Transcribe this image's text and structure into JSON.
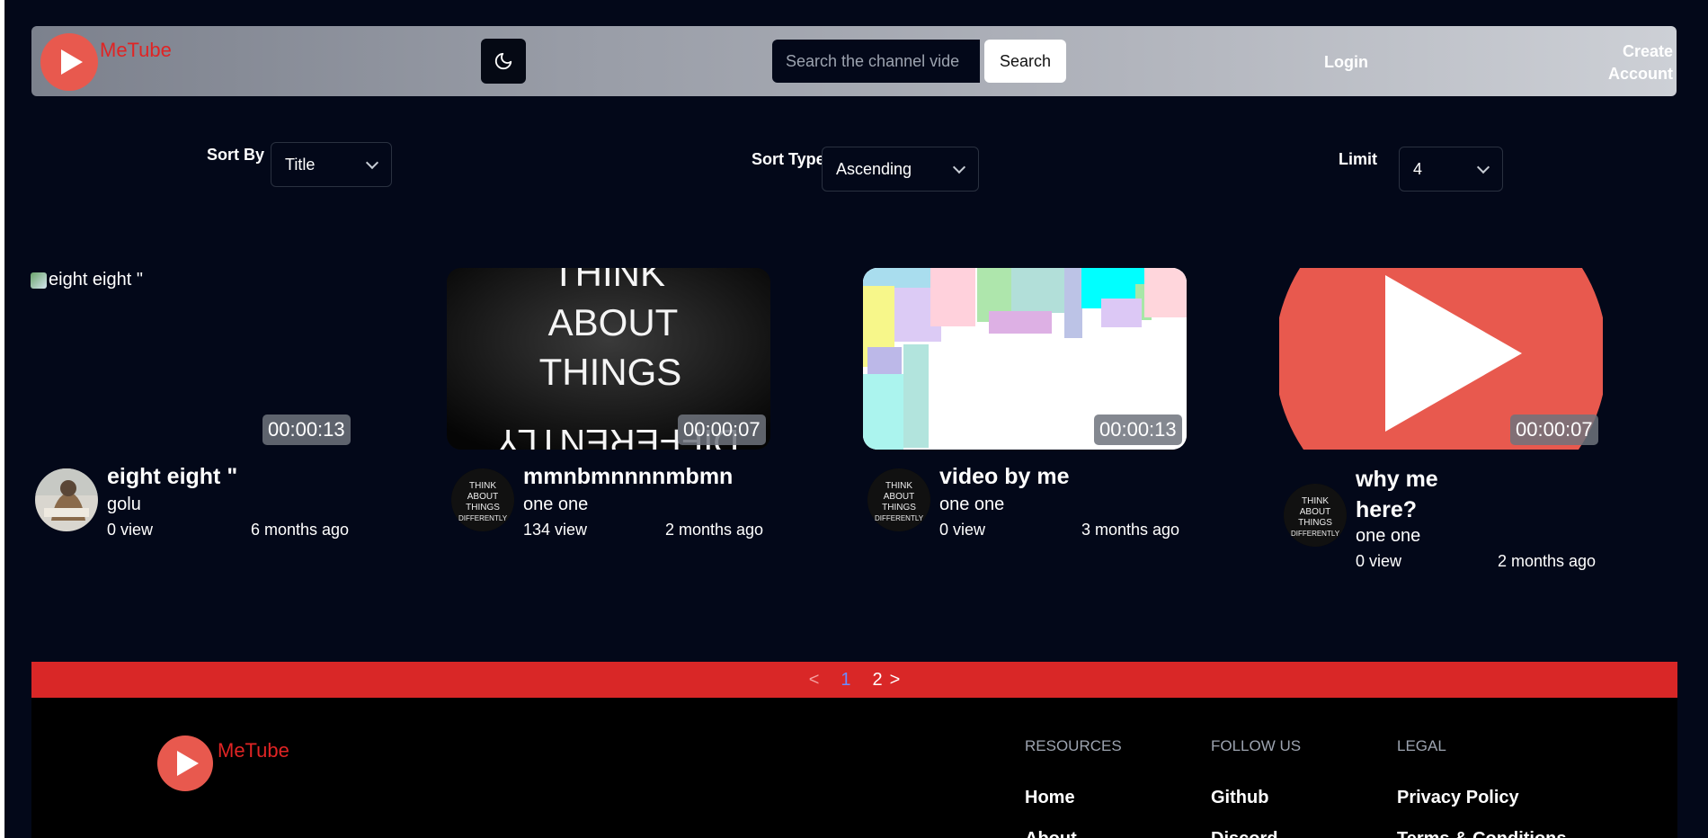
{
  "header": {
    "brand": "MeTube",
    "search_placeholder": "Search the channel vide",
    "search_label": "Search",
    "login": "Login",
    "create_account": "Create Account"
  },
  "sort": {
    "sort_by_label": "Sort By",
    "sort_by_value": "Title",
    "sort_type_label": "Sort Type",
    "sort_type_value": "Ascending",
    "limit_label": "Limit",
    "limit_value": "4"
  },
  "videos": [
    {
      "title": "eight eight \"",
      "thumb_alt": "eight eight \"",
      "duration": "00:00:13",
      "channel": "golu",
      "views": "0 view",
      "ago": "6 months ago"
    },
    {
      "title": "mmnbmnnnnmbmn",
      "duration": "00:00:07",
      "channel": "one one",
      "views": "134 view",
      "ago": "2 months ago"
    },
    {
      "title": "video by me",
      "duration": "00:00:13",
      "channel": "one one",
      "views": "0 view",
      "ago": "3 months ago"
    },
    {
      "title_line1": "why me",
      "title_line2": "here?",
      "duration": "00:00:07",
      "channel": "one one",
      "views": "0 view",
      "ago": "2 months ago"
    }
  ],
  "thumb_text": {
    "line1": "THINK",
    "line2": "ABOUT",
    "line3": "THINGS",
    "line4": "DIFFERENTLY"
  },
  "pagination": {
    "prev": "<",
    "page1": "1",
    "page2": "2",
    "next": ">"
  },
  "footer": {
    "brand": "MeTube",
    "resources": "RESOURCES",
    "follow": "FOLLOW US",
    "legal": "LEGAL",
    "home": "Home",
    "github": "Github",
    "privacy": "Privacy Policy",
    "about": "About",
    "discord": "Discord",
    "terms": "Terms & Conditions"
  },
  "colors": {
    "accent": "#e02424",
    "bg": "#030819",
    "pager": "#d92727"
  }
}
